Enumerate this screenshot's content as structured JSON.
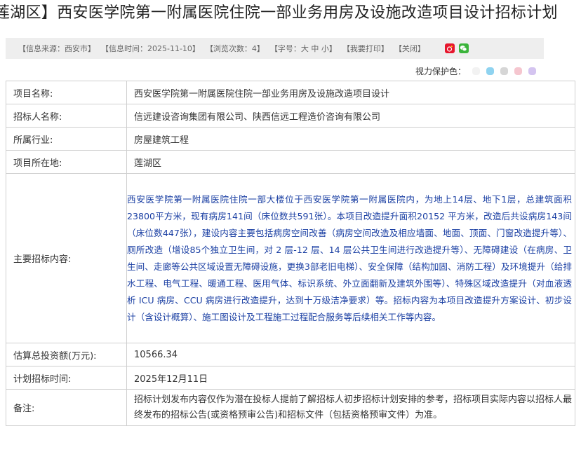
{
  "page": {
    "title": "莲湖区】西安医学院第一附属医院住院一部业务用房及设施改造项目设计招标计划"
  },
  "info_bar": {
    "source": "【信息来源：西安市】",
    "time": "【信息时间：2025-11-10】",
    "views": "【浏览次数：4】",
    "font_size": "【字号：大 中 小】",
    "print": "【我要打印】",
    "close": "【关闭】"
  },
  "share_icons": [
    "weibo-icon",
    "wechat-icon"
  ],
  "eye_protect": {
    "label": "视力保护色：",
    "colors": [
      "#f2f2f2",
      "#8fd3f0",
      "#d6d6d6",
      "#f5c6cf",
      "#d4c4f0"
    ]
  },
  "table": {
    "rows": [
      {
        "label": "项目名称:",
        "value": "西安医学院第一附属医院住院一部业务用房及设施改造项目设计"
      },
      {
        "label": "招标人名称:",
        "value": "信远建设咨询集团有限公司、陕西信远工程造价咨询有限公司"
      },
      {
        "label": "所属行业:",
        "value": "房屋建筑工程"
      },
      {
        "label": "项目所在地:",
        "value": "莲湖区"
      },
      {
        "label": "主要招标内容:",
        "value": "西安医学院第一附属医院住院一部大楼位于西安医学院第一附属医院内，为地上14层、地下1层，总建筑面积23800平方米，现有病房141间（床位数共591张）。本项目改造提升面积20152 平方米，改造后共设病房143间（床位数447张），建设内容主要包括病房空间改善（病房空间改造及相应墙面、地面、顶面、门窗改造提升等）、厕所改造（增设85个独立卫生间，对 2 层-12 层、14 层公共卫生间进行改造提升等）、无障碍建设（在病房、卫生间、走廊等公共区域设置无障碍设施，更换3部老旧电梯）、安全保障（结构加固、消防工程）及环境提升（给排水工程、电气工程、暖通工程、医用气体、标识系统、外立面翻新及建筑外围等）、特殊区域改造提升（对血液透析 ICU 病房、CCU 病房进行改造提升，达到十万级洁净要求）等。招标内容为本项目改造提升方案设计、初步设计（含设计概算）、施工图设计及工程施工过程配合服务等后续相关工作等内容。"
      },
      {
        "label": "估算总投资额(万元):",
        "value": "10566.34"
      },
      {
        "label": "计划招标时间:",
        "value": "2025年12月11日"
      },
      {
        "label": "备注:",
        "value": "招标计划发布内容仅作为潜在投标人提前了解招标人初步招标计划安排的参考，招标项目实际内容以招标人最终发布的招标公告(或资格预审公告)和招标文件（包括资格预审文件）为准。"
      }
    ]
  }
}
